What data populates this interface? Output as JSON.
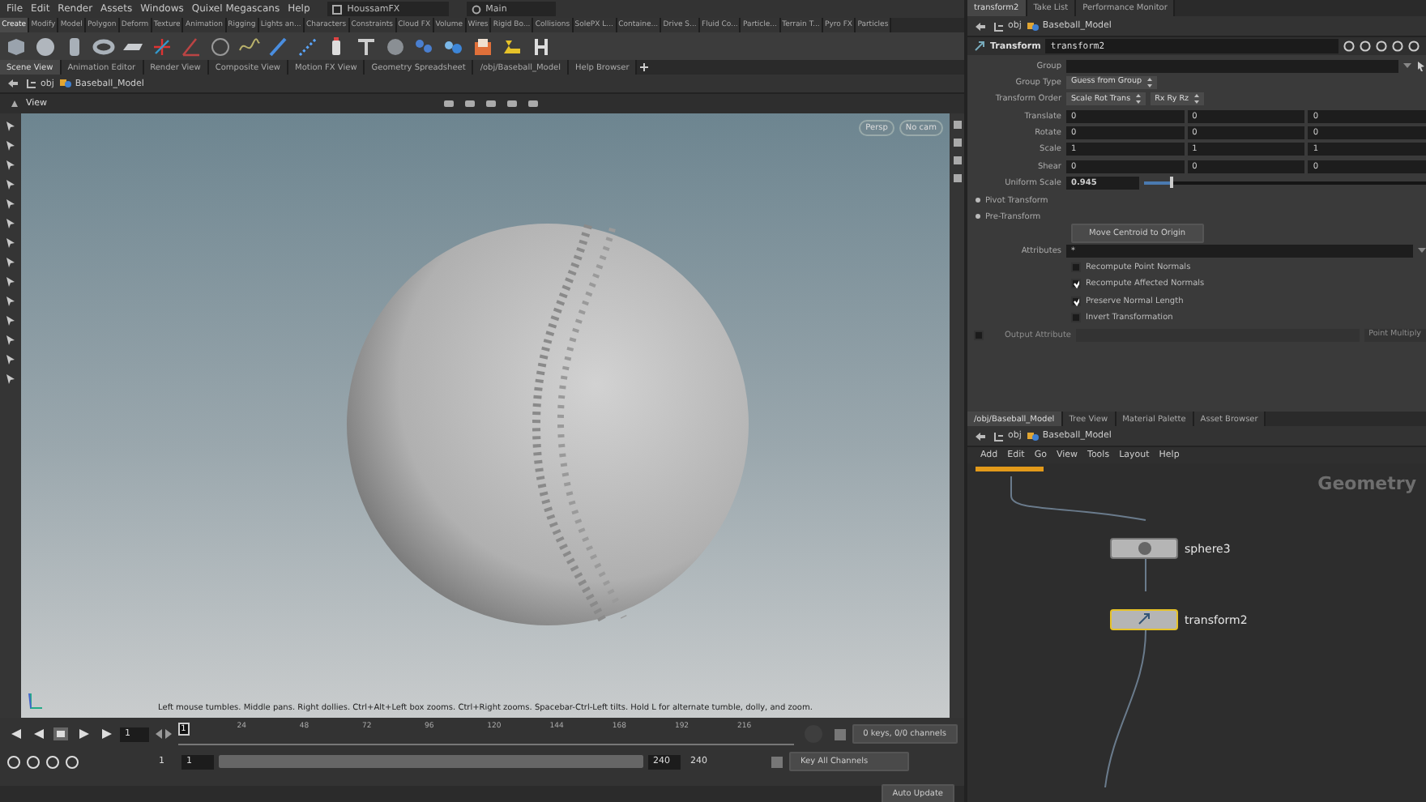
{
  "menubar": {
    "menus": [
      "File",
      "Edit",
      "Render",
      "Assets",
      "Windows",
      "Quixel Megascans",
      "Help"
    ],
    "desktop": "HoussamFX",
    "layout": "Main"
  },
  "shelf_tabs": [
    {
      "label": "Create",
      "selected": true
    },
    {
      "label": "Modify",
      "selected": false
    },
    {
      "label": "Model",
      "selected": false
    },
    {
      "label": "Polygon",
      "selected": false
    },
    {
      "label": "Deform",
      "selected": false
    },
    {
      "label": "Texture",
      "selected": false
    },
    {
      "label": "Animation",
      "selected": false
    },
    {
      "label": "Rigging",
      "selected": false
    },
    {
      "label": "Lights an...",
      "selected": false
    },
    {
      "label": "Characters",
      "selected": false
    },
    {
      "label": "Constraints",
      "selected": false
    },
    {
      "label": "Cloud FX",
      "selected": false
    },
    {
      "label": "Volume",
      "selected": false
    },
    {
      "label": "Wires",
      "selected": false
    },
    {
      "label": "Rigid Bo...",
      "selected": false
    },
    {
      "label": "Collisions",
      "selected": false
    },
    {
      "label": "SolePX L...",
      "selected": false
    },
    {
      "label": "Containe...",
      "selected": false
    },
    {
      "label": "Drive S...",
      "selected": false
    },
    {
      "label": "Fluid Co...",
      "selected": false
    },
    {
      "label": "Particle...",
      "selected": false
    },
    {
      "label": "Terrain T...",
      "selected": false
    },
    {
      "label": "Pyro FX",
      "selected": false
    },
    {
      "label": "Particles",
      "selected": false
    }
  ],
  "pane_tabs": [
    {
      "label": "Scene View",
      "selected": true
    },
    {
      "label": "Animation Editor",
      "selected": false
    },
    {
      "label": "Render View",
      "selected": false
    },
    {
      "label": "Composite View",
      "selected": false
    },
    {
      "label": "Motion FX View",
      "selected": false
    },
    {
      "label": "Geometry Spreadsheet",
      "selected": false
    },
    {
      "label": "/obj/Baseball_Model",
      "selected": false
    },
    {
      "label": "Help Browser",
      "selected": false
    }
  ],
  "path": [
    "obj",
    "Baseball_Model"
  ],
  "viewer": {
    "title": "View",
    "camera_menus": [
      "Persp",
      "No cam"
    ],
    "status": "Left mouse tumbles. Middle pans. Right dollies. Ctrl+Alt+Left box zooms. Ctrl+Right zooms. Spacebar-Ctrl-Left tilts. Hold L for alternate tumble, dolly, and zoom."
  },
  "timeline": {
    "frame": "1",
    "current": "1",
    "ticks": [
      "24",
      "48",
      "72",
      "96",
      "120",
      "144",
      "168",
      "192",
      "216"
    ],
    "range": [
      "1",
      "1",
      "240",
      "240"
    ],
    "range_bar": {
      "level": 1
    },
    "keys_info": "0 keys, 0/0 channels",
    "key_button": "Key All Channels",
    "update": "Auto Update"
  },
  "parameter_tabs": [
    {
      "label": "transform2",
      "selected": true
    },
    {
      "label": "Take List",
      "selected": false
    },
    {
      "label": "Performance Monitor",
      "selected": false
    }
  ],
  "parameter_path": [
    "obj",
    "Baseball_Model"
  ],
  "node_header": {
    "type": "Transform",
    "name": "transform2"
  },
  "parameters": [
    {
      "kind": "field",
      "label": "Group"
    },
    {
      "kind": "menu",
      "label": "Group Type",
      "options": [
        "Guess from Group"
      ]
    },
    {
      "kind": "menu",
      "label": "Transform Order",
      "options": [
        "Scale Rot Trans",
        "Rx Ry Rz"
      ]
    },
    {
      "kind": "vector",
      "label": "Translate",
      "values": [
        "0",
        "0",
        "0"
      ]
    },
    {
      "kind": "vector",
      "label": "Rotate",
      "values": [
        "0",
        "0",
        "0"
      ]
    },
    {
      "kind": "vector",
      "label": "Scale",
      "values": [
        "1",
        "1",
        "1"
      ]
    },
    {
      "kind": "vector",
      "label": "Shear",
      "values": [
        "0",
        "0",
        "0"
      ]
    },
    {
      "kind": "slider",
      "label": "Uniform Scale",
      "value": "0.945",
      "level": 0.1
    },
    {
      "kind": "folder",
      "label": "Pivot Transform"
    },
    {
      "kind": "folder",
      "label": "Pre-Transform"
    },
    {
      "kind": "button",
      "label": "Move Centroid to Origin"
    },
    {
      "kind": "field",
      "label": "Attributes",
      "value": "*"
    },
    {
      "kind": "checkbox",
      "label": "Recompute Point Normals",
      "checked": false
    },
    {
      "kind": "checkbox",
      "label": "Recompute Affected Normals",
      "checked": true
    },
    {
      "kind": "checkbox",
      "label": "Preserve Normal Length",
      "checked": true
    },
    {
      "kind": "checkbox",
      "label": "Invert Transformation",
      "checked": false
    },
    {
      "kind": "toggle_field",
      "label": "Output Attribute",
      "checked": false,
      "menu": "Point Multiply"
    }
  ],
  "network_tabs": [
    {
      "label": "/obj/Baseball_Model",
      "selected": true
    },
    {
      "label": "Tree View",
      "selected": false
    },
    {
      "label": "Material Palette",
      "selected": false
    },
    {
      "label": "Asset Browser",
      "selected": false
    }
  ],
  "network_path": [
    "obj",
    "Baseball_Model"
  ],
  "network_menu": [
    "Add",
    "Edit",
    "Go",
    "View",
    "Tools",
    "Layout",
    "Help"
  ],
  "network": {
    "context": "Geometry",
    "nodes": [
      {
        "name": "sphere3",
        "selected": false
      },
      {
        "name": "transform2",
        "selected": true
      }
    ]
  }
}
